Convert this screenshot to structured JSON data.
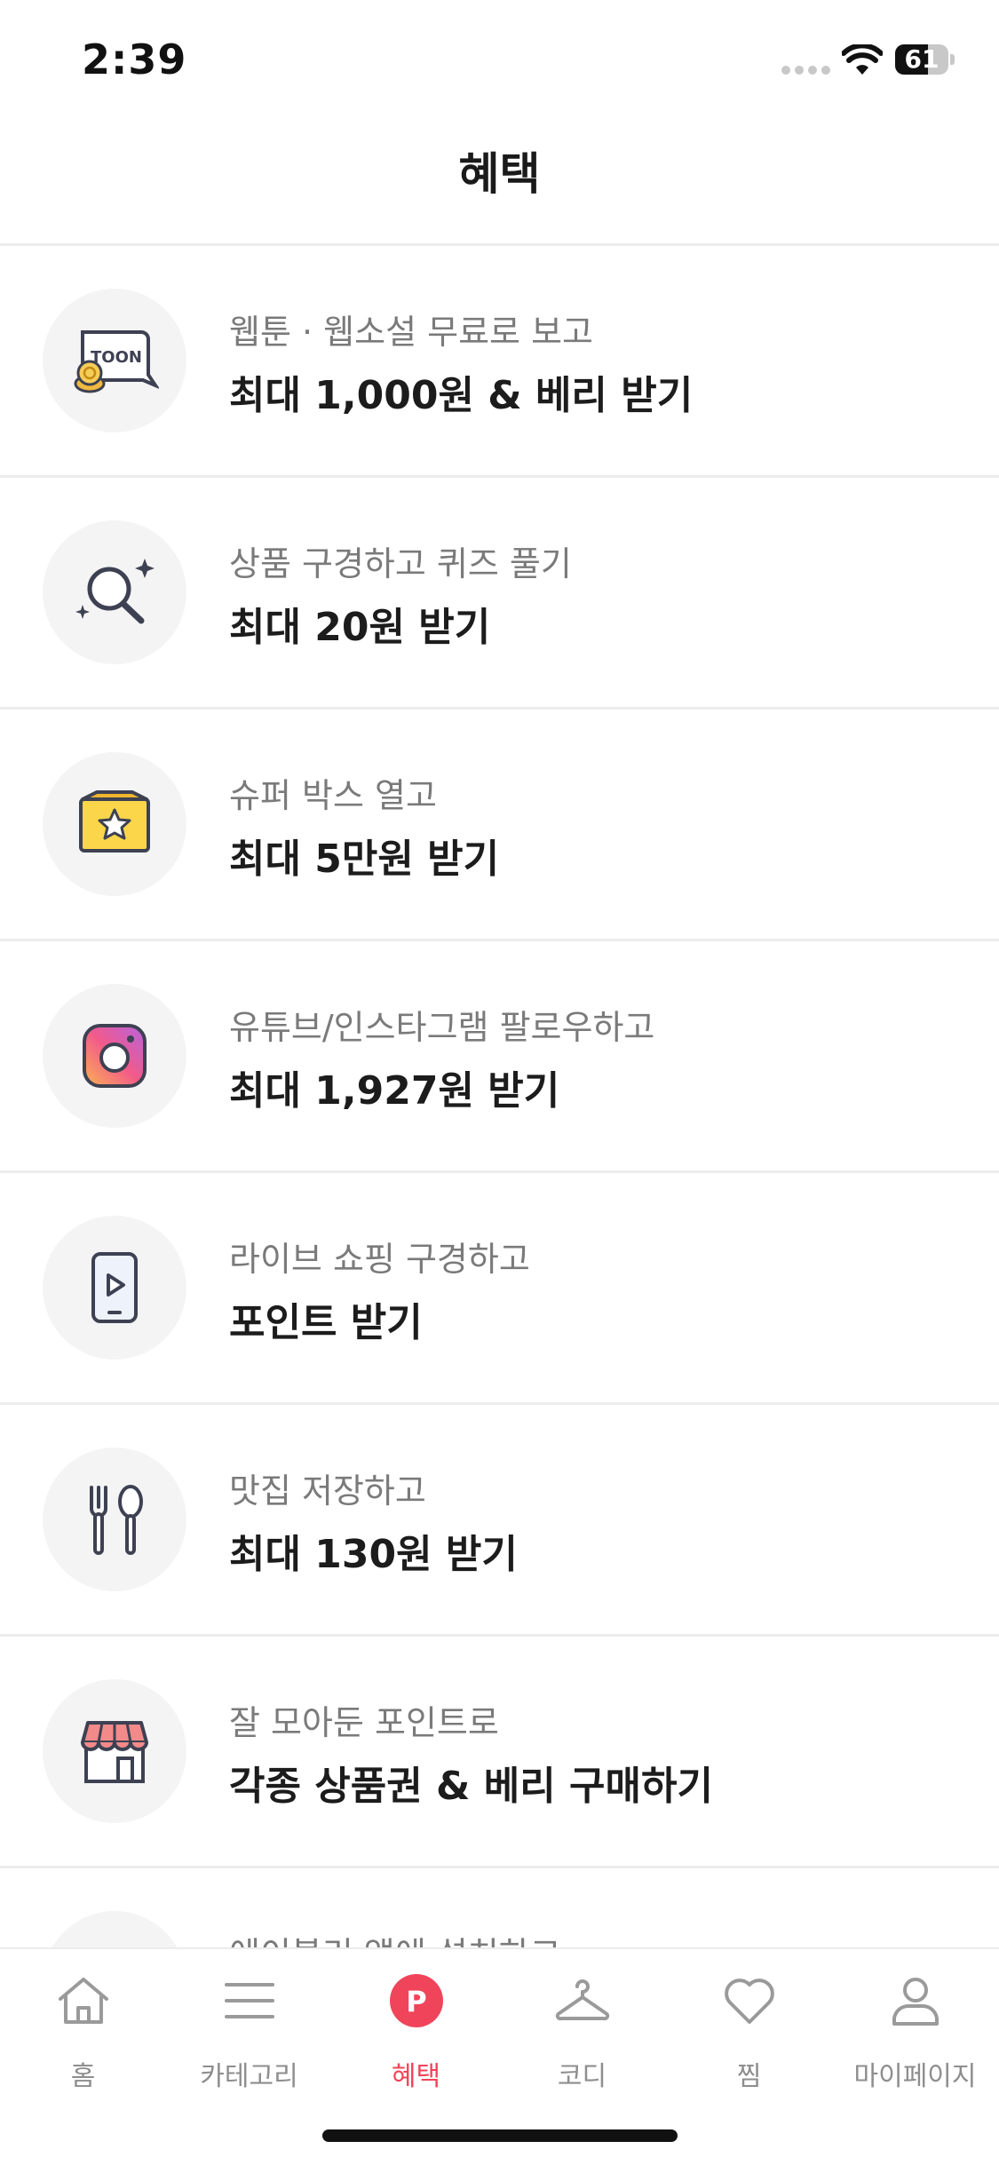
{
  "status_bar": {
    "time": "2:39",
    "battery": "61",
    "battery_level": 0.61
  },
  "header": {
    "title": "혜택"
  },
  "benefits": [
    {
      "icon": "toon-icon",
      "subtitle": "웹툰 · 웹소설 무료로 보고",
      "title": "최대 1,000원 & 베리 받기"
    },
    {
      "icon": "magnifier-sparkle-icon",
      "subtitle": "상품 구경하고 퀴즈 풀기",
      "title": "최대 20원 받기"
    },
    {
      "icon": "star-box-icon",
      "subtitle": "슈퍼 박스 열고",
      "title": "최대 5만원 받기"
    },
    {
      "icon": "instagram-icon",
      "subtitle": "유튜브/인스타그램 팔로우하고",
      "title": "최대 1,927원 받기"
    },
    {
      "icon": "live-video-phone-icon",
      "subtitle": "라이브 쇼핑 구경하고",
      "title": "포인트 받기"
    },
    {
      "icon": "fork-spoon-icon",
      "subtitle": "맛집 저장하고",
      "title": "최대 130원 받기"
    },
    {
      "icon": "store-icon",
      "subtitle": "잘 모아둔 포인트로",
      "title": "각종 상품권 & 베리 구매하기"
    },
    {
      "icon": "app-install-icon",
      "subtitle": "에이블리 앱에 설치하고",
      "title": ""
    }
  ],
  "tabbar": {
    "tabs": [
      {
        "label": "홈",
        "icon": "home-icon"
      },
      {
        "label": "카테고리",
        "icon": "menu-icon"
      },
      {
        "label": "혜택",
        "icon": "point-p-icon",
        "active": true
      },
      {
        "label": "코디",
        "icon": "hanger-icon"
      },
      {
        "label": "찜",
        "icon": "heart-icon"
      },
      {
        "label": "마이페이지",
        "icon": "person-icon"
      }
    ]
  },
  "colors": {
    "accent": "#f0445a",
    "divider": "#ececec",
    "icon_bg": "#f4f4f5"
  }
}
